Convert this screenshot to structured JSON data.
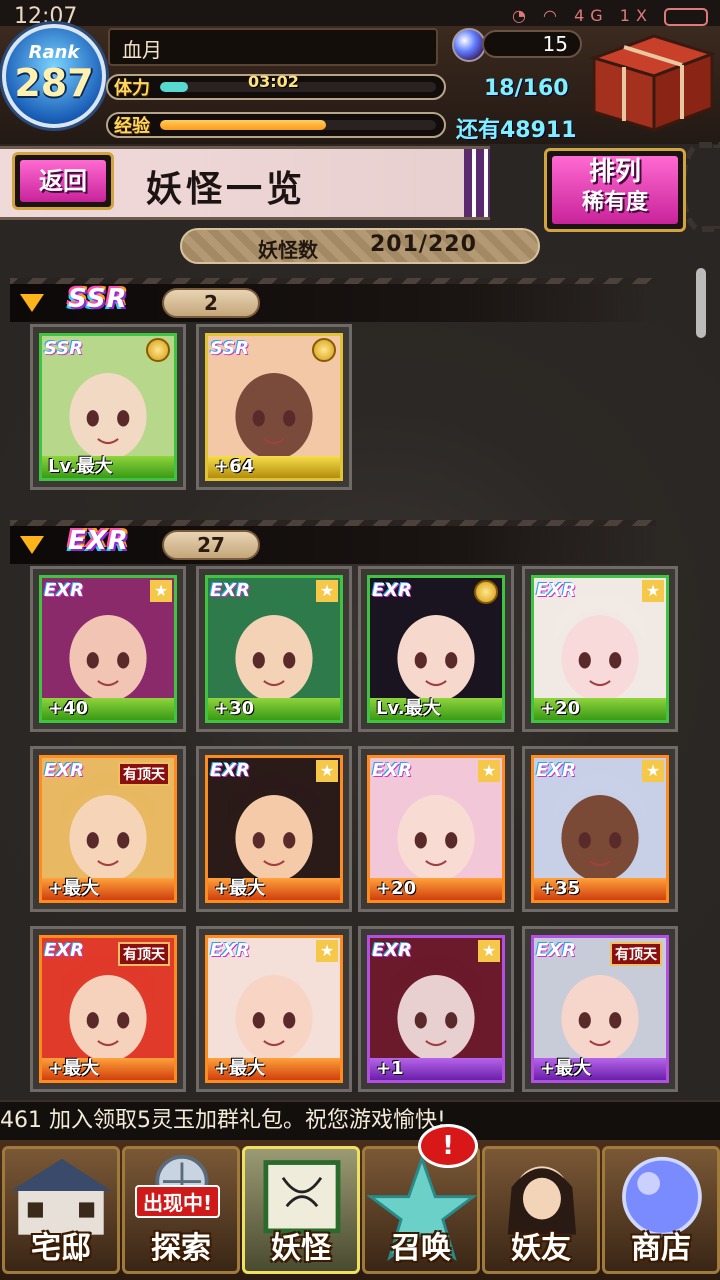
{
  "status_bar": {
    "time": "12:07",
    "network": "4G 1X"
  },
  "player": {
    "rank_label": "Rank",
    "rank": "287",
    "name": "血月",
    "stamina_label": "体力",
    "stamina_timer": "03:02",
    "stamina_fill": 0.1,
    "exp_label": "经验",
    "exp_fill": 0.6,
    "orbs": "15",
    "stamina_value": "18/160",
    "money_text": "还有48911"
  },
  "page": {
    "back_label": "返回",
    "title": "妖怪一览",
    "sort_label": "排列",
    "sort_value": "稀有度",
    "count_label": "妖怪数",
    "count_value": "201/220"
  },
  "sections": [
    {
      "rarity": "SSR",
      "count": "2",
      "cards": [
        {
          "badge": "SSR",
          "footer": "Lv.最大",
          "frame": "green",
          "medal": true,
          "palette": [
            "#b7d88a",
            "#f2d9c4"
          ]
        },
        {
          "badge": "SSR",
          "footer": "+64",
          "frame": "gold",
          "medal": true,
          "palette": [
            "#f3c8a6",
            "#7a4a3a"
          ]
        }
      ]
    },
    {
      "rarity": "EXR",
      "count": "27",
      "cards": [
        {
          "badge": "EXR",
          "footer": "+40",
          "frame": "green",
          "star": true,
          "palette": [
            "#8a2a6a",
            "#f2c4b4"
          ]
        },
        {
          "badge": "EXR",
          "footer": "+30",
          "frame": "green",
          "star": true,
          "palette": [
            "#2e7a4a",
            "#f4d2b6"
          ]
        },
        {
          "badge": "EXR",
          "footer": "Lv.最大",
          "frame": "green",
          "medal": true,
          "palette": [
            "#1a1420",
            "#f6d9cc"
          ]
        },
        {
          "badge": "EXR",
          "footer": "+20",
          "frame": "green",
          "star": true,
          "palette": [
            "#f1eae4",
            "#f8dada"
          ]
        },
        {
          "badge": "EXR",
          "footer": "+最大",
          "frame": "orange",
          "tag": "有顶天",
          "palette": [
            "#e8b862",
            "#f6d4b8"
          ]
        },
        {
          "badge": "EXR",
          "footer": "+最大",
          "frame": "orange",
          "star": true,
          "palette": [
            "#2a1a18",
            "#f4caa8"
          ]
        },
        {
          "badge": "EXR",
          "footer": "+20",
          "frame": "orange",
          "star": true,
          "palette": [
            "#f2c8d8",
            "#f8dcd4"
          ]
        },
        {
          "badge": "EXR",
          "footer": "+35",
          "frame": "orange",
          "star": true,
          "palette": [
            "#c8d0e8",
            "#7a4a36"
          ]
        },
        {
          "badge": "EXR",
          "footer": "+最大",
          "frame": "orange",
          "tag": "有顶天",
          "palette": [
            "#e03a2a",
            "#f6d2bc"
          ]
        },
        {
          "badge": "EXR",
          "footer": "+最大",
          "frame": "orange",
          "star": true,
          "palette": [
            "#f4e0d8",
            "#f7d4c4"
          ]
        },
        {
          "badge": "EXR",
          "footer": "+1",
          "frame": "purple",
          "star": true,
          "palette": [
            "#6a1a2a",
            "#e8d0d0"
          ]
        },
        {
          "badge": "EXR",
          "footer": "+最大",
          "frame": "purple",
          "tag": "有顶天",
          "palette": [
            "#c8ccd8",
            "#f6d6ca"
          ]
        }
      ]
    }
  ],
  "ticker": "461   加入领取5灵玉加群礼包。祝您游戏愉快!",
  "nav": [
    {
      "label": "宅邸",
      "icon": "house-icon"
    },
    {
      "label": "探索",
      "icon": "explore-icon",
      "badge": "出现中!"
    },
    {
      "label": "妖怪",
      "icon": "scroll-icon",
      "active": true
    },
    {
      "label": "召唤",
      "icon": "pentagram-icon"
    },
    {
      "label": "妖友",
      "icon": "friend-icon"
    },
    {
      "label": "商店",
      "icon": "crystal-ball-icon"
    }
  ],
  "summon_alert": "!",
  "colors": {
    "accent_pink": "#e23bb4",
    "gold": "#d1a53c",
    "cyan_value": "#7ff0ff"
  }
}
